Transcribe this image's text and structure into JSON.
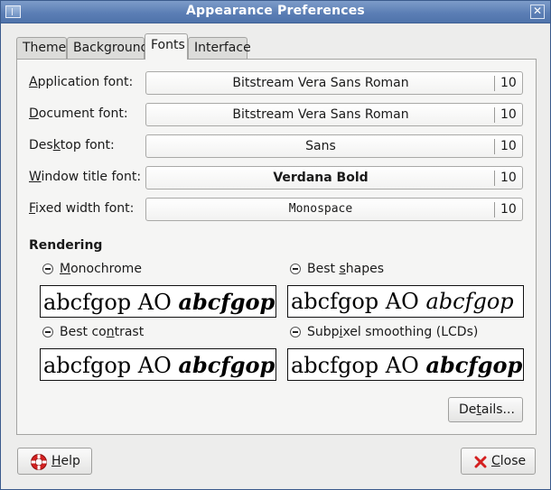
{
  "window": {
    "title": "Appearance Preferences"
  },
  "tabs": [
    {
      "label": "Theme"
    },
    {
      "label": "Background"
    },
    {
      "label": "Fonts"
    },
    {
      "label": "Interface"
    }
  ],
  "active_tab": "Fonts",
  "fonts": [
    {
      "label_pre": "",
      "label_mn": "A",
      "label_post": "pplication font:",
      "value": "Bitstream Vera Sans Roman",
      "size": "10"
    },
    {
      "label_pre": "",
      "label_mn": "D",
      "label_post": "ocument font:",
      "value": "Bitstream Vera Sans Roman",
      "size": "10"
    },
    {
      "label_pre": "Des",
      "label_mn": "k",
      "label_post": "top font:",
      "value": "Sans",
      "size": "10"
    },
    {
      "label_pre": "",
      "label_mn": "W",
      "label_post": "indow title font:",
      "value": "Verdana Bold",
      "size": "10"
    },
    {
      "label_pre": "",
      "label_mn": "F",
      "label_post": "ixed width font:",
      "value": "Monospace",
      "size": "10"
    }
  ],
  "rendering": {
    "heading": "Rendering",
    "sample_plain": "abcfgop AO",
    "sample_bold_italic": "abcfgop",
    "options": [
      {
        "pre": "",
        "mn": "M",
        "post": "onochrome"
      },
      {
        "pre": "Best ",
        "mn": "s",
        "post": "hapes"
      },
      {
        "pre": "Best co",
        "mn": "n",
        "post": "trast"
      },
      {
        "pre": "Subp",
        "mn": "i",
        "post": "xel smoothing (LCDs)"
      }
    ]
  },
  "buttons": {
    "details": {
      "pre": "De",
      "mn": "t",
      "post": "ails..."
    },
    "help": {
      "pre": "",
      "mn": "H",
      "post": "elp"
    },
    "close": {
      "pre": "",
      "mn": "C",
      "post": "lose"
    }
  },
  "colors": {
    "titlebar": "#5c7fb5",
    "close_icon": "#d42020",
    "help_icon": "#d42020"
  }
}
